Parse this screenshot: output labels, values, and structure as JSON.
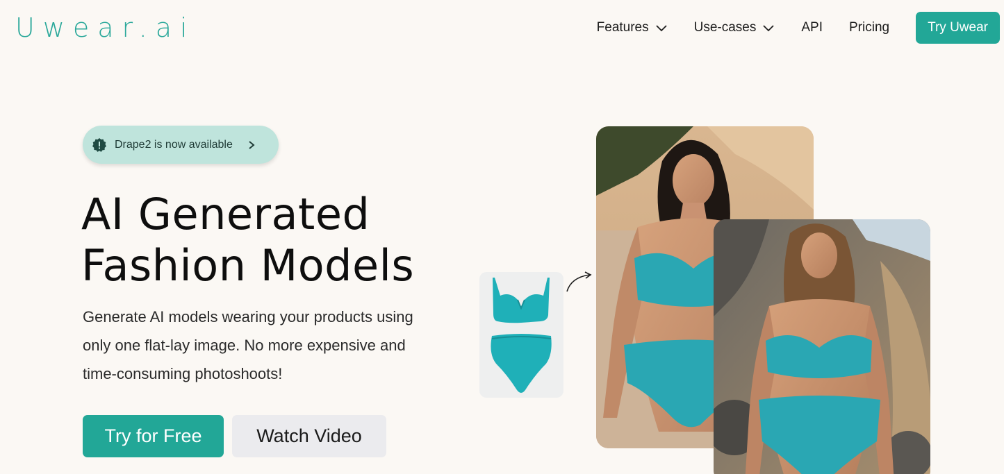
{
  "header": {
    "logo": "Uwear.ai",
    "nav": {
      "features": "Features",
      "use_cases": "Use-cases",
      "api": "API",
      "pricing": "Pricing",
      "cta": "Try Uwear"
    }
  },
  "announcement": {
    "text": "Drape2 is now available"
  },
  "hero": {
    "title_line1": "AI Generated",
    "title_line2": "Fashion Models",
    "description": "Generate AI models wearing your products using only one flat-lay image. No more expensive and time-consuming photoshoots!",
    "primary_button": "Try for Free",
    "secondary_button": "Watch Video"
  },
  "colors": {
    "accent": "#22a797",
    "pill_bg": "#bfe4dc",
    "page_bg": "#fbf8f4",
    "swimsuit": "#2aa7b3"
  },
  "icons": {
    "nav_dropdown": "chevron-down-icon",
    "pill_badge": "alert-badge-icon",
    "pill_arrow": "chevron-right-icon",
    "flow_arrow": "curved-arrow-icon"
  }
}
